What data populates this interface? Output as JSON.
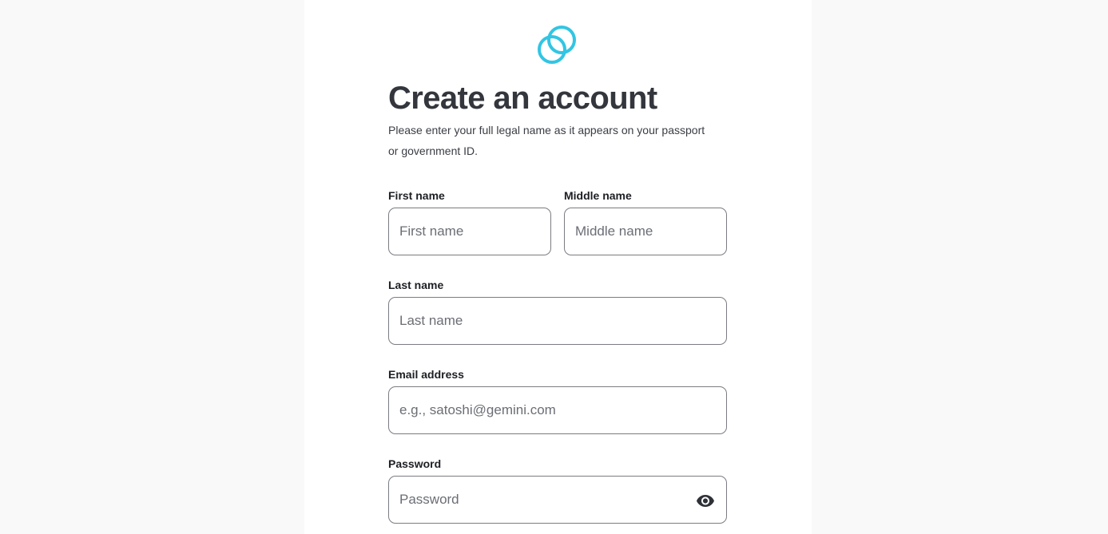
{
  "brand": {
    "logo_icon": "gemini-logo-icon",
    "accent_color": "#32c5e3"
  },
  "page": {
    "title": "Create an account",
    "subtitle": "Please enter your full legal name as it appears on your passport or government ID."
  },
  "form": {
    "first_name": {
      "label": "First name",
      "placeholder": "First name",
      "value": ""
    },
    "middle_name": {
      "label": "Middle name",
      "placeholder": "Middle name",
      "value": ""
    },
    "last_name": {
      "label": "Last name",
      "placeholder": "Last name",
      "value": ""
    },
    "email": {
      "label": "Email address",
      "placeholder": "e.g., satoshi@gemini.com",
      "value": ""
    },
    "password": {
      "label": "Password",
      "placeholder": "Password",
      "value": "",
      "toggle_icon": "eye-icon"
    }
  }
}
